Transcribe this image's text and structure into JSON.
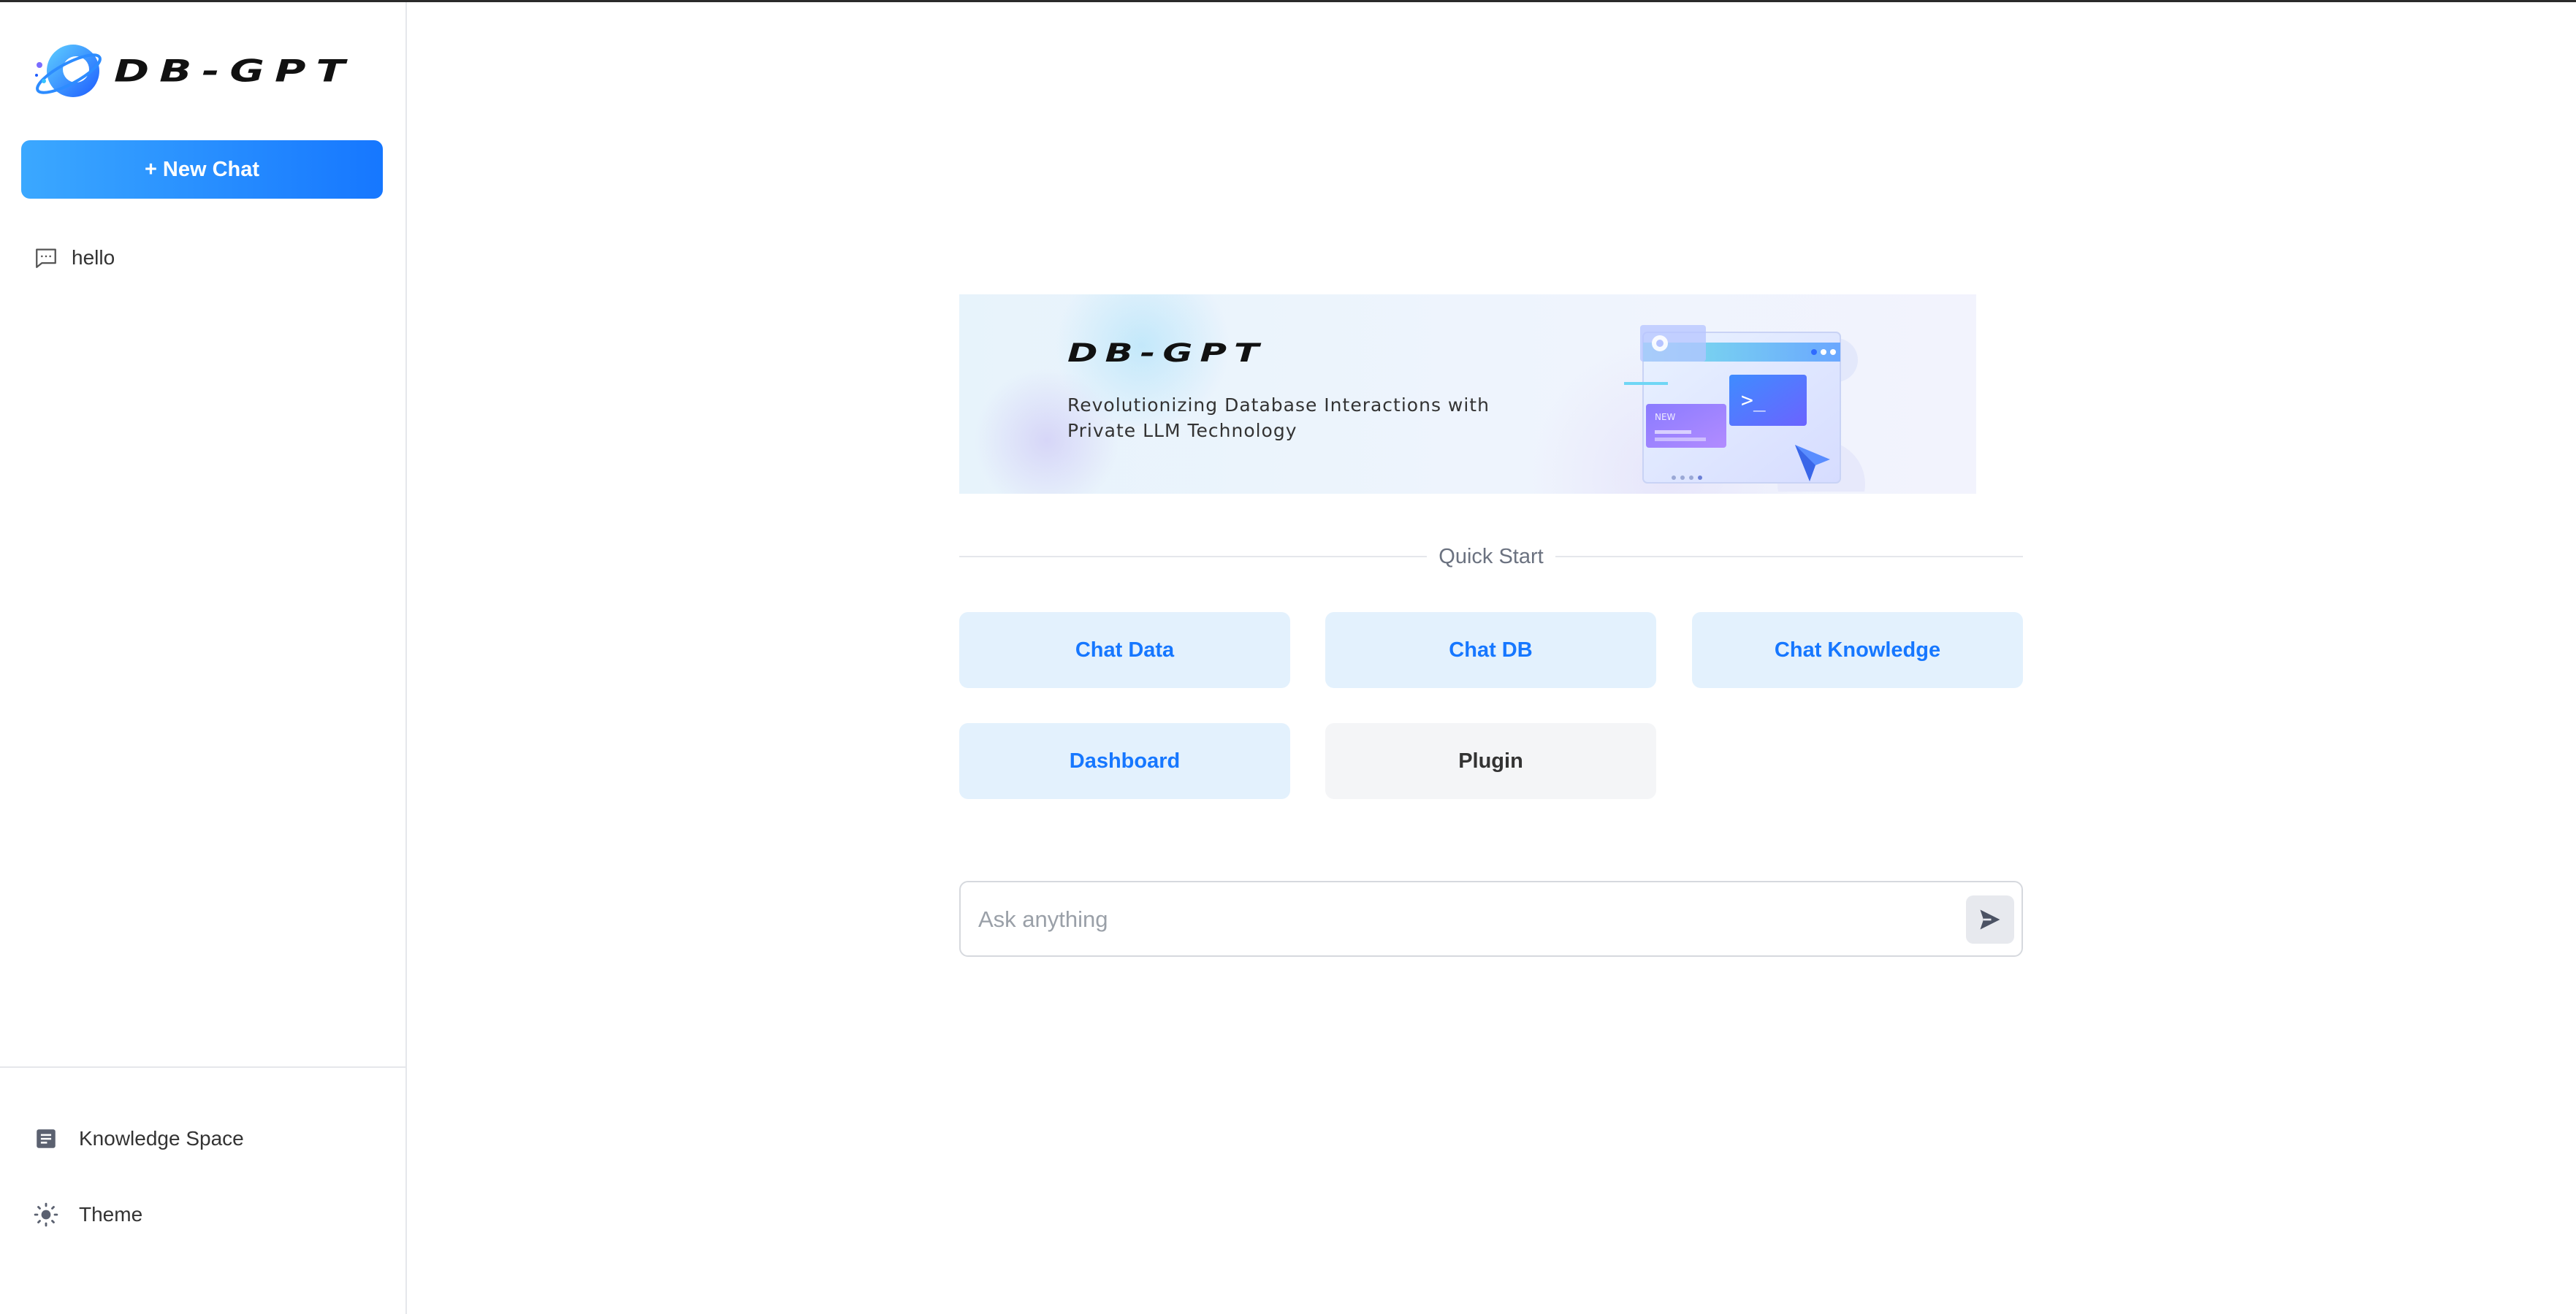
{
  "brand": {
    "logo_text": "DB-GPT",
    "accent_color": "#1677ff"
  },
  "sidebar": {
    "new_chat_label": "+ New Chat",
    "history": [
      {
        "label": "hello",
        "icon": "chat-message-icon"
      }
    ],
    "bottom_items": [
      {
        "label": "Knowledge Space",
        "icon": "document-icon"
      },
      {
        "label": "Theme",
        "icon": "sun-icon"
      }
    ]
  },
  "main": {
    "banner": {
      "title": "DB-GPT",
      "subtitle_line1": "Revolutionizing Database Interactions with",
      "subtitle_line2": "Private LLM Technology",
      "illustration_text": ">_",
      "illustration_badge": "NEW"
    },
    "quick_start": {
      "label": "Quick Start",
      "buttons": [
        {
          "label": "Chat Data"
        },
        {
          "label": "Chat DB"
        },
        {
          "label": "Chat Knowledge"
        },
        {
          "label": "Dashboard"
        },
        {
          "label": "Plugin"
        }
      ]
    },
    "input": {
      "placeholder": "Ask anything",
      "value": ""
    }
  }
}
